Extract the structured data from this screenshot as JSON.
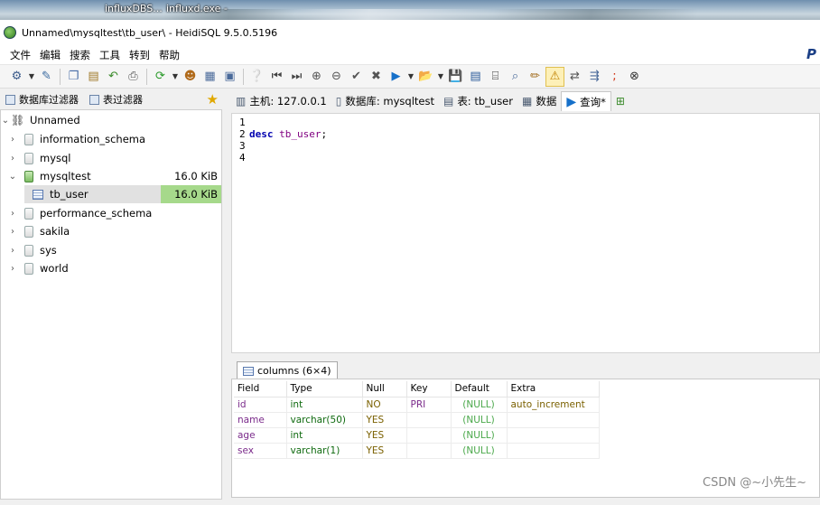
{
  "desktop": {
    "label1": "influxDBS...",
    "label2": "influxd.exe -"
  },
  "window": {
    "title": "Unnamed\\mysqltest\\tb_user\\ - HeidiSQL 9.5.0.5196"
  },
  "menu": {
    "items": [
      "文件",
      "编辑",
      "搜索",
      "工具",
      "转到",
      "帮助"
    ]
  },
  "left_tabs": {
    "db_filter": "数据库过滤器",
    "table_filter": "表过滤器"
  },
  "tree": {
    "root": "Unnamed",
    "databases": [
      {
        "name": "information_schema",
        "size": ""
      },
      {
        "name": "mysql",
        "size": ""
      },
      {
        "name": "mysqltest",
        "size": "16.0 KiB"
      },
      {
        "name": "tb_user",
        "size": "16.0 KiB"
      },
      {
        "name": "performance_schema",
        "size": ""
      },
      {
        "name": "sakila",
        "size": ""
      },
      {
        "name": "sys",
        "size": ""
      },
      {
        "name": "world",
        "size": ""
      }
    ]
  },
  "right_tabs": {
    "host": "主机: 127.0.0.1",
    "database": "数据库: mysqltest",
    "table": "表: tb_user",
    "data": "数据",
    "query": "查询*"
  },
  "editor": {
    "line_numbers": [
      "1",
      "2",
      "3",
      "4"
    ],
    "keyword": "desc",
    "identifier": "tb_user",
    "terminator": ";"
  },
  "result_tab": {
    "label": "columns (6×4)"
  },
  "result_grid": {
    "headers": [
      "Field",
      "Type",
      "Null",
      "Key",
      "Default",
      "Extra"
    ],
    "rows": [
      [
        "id",
        "int",
        "NO",
        "PRI",
        "(NULL)",
        "auto_increment"
      ],
      [
        "name",
        "varchar(50)",
        "YES",
        "",
        "(NULL)",
        ""
      ],
      [
        "age",
        "int",
        "YES",
        "",
        "(NULL)",
        ""
      ],
      [
        "sex",
        "varchar(1)",
        "YES",
        "",
        "(NULL)",
        ""
      ]
    ]
  },
  "watermark": "CSDN @~小先生~"
}
